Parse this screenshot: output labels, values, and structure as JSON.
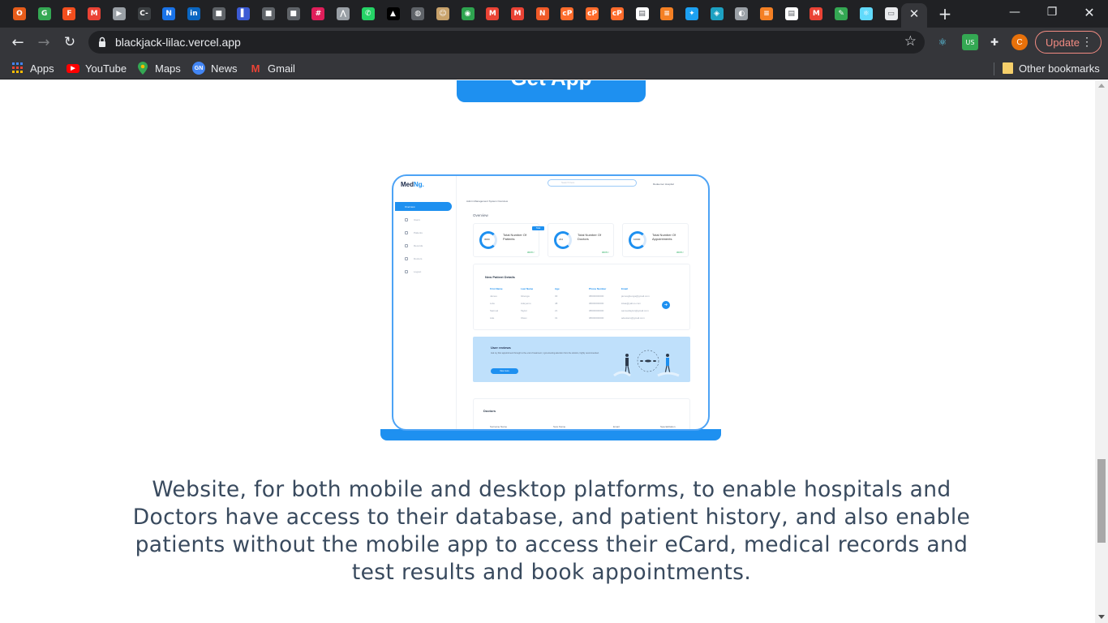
{
  "browser": {
    "tabs": [
      {
        "icon": "opera-icon",
        "color": "#e65c1a",
        "glyph": "O"
      },
      {
        "icon": "chrome-icon",
        "color": "#34a853",
        "glyph": "G"
      },
      {
        "icon": "figma-icon",
        "color": "#f24e1e",
        "glyph": "F"
      },
      {
        "icon": "gmail-icon",
        "color": "#ea4335",
        "glyph": "M"
      },
      {
        "icon": "media-icon",
        "color": "#9aa0a6",
        "glyph": "▶"
      },
      {
        "icon": "codepen-c-icon",
        "color": "#3c4043",
        "glyph": "C-"
      },
      {
        "icon": "notion-n-icon",
        "color": "#1a73e8",
        "glyph": "N"
      },
      {
        "icon": "linkedin-icon",
        "color": "#0a66c2",
        "glyph": "in"
      },
      {
        "icon": "app-icon",
        "color": "#5f6368",
        "glyph": "■"
      },
      {
        "icon": "figure-icon",
        "color": "#3c5bd4",
        "glyph": "▌"
      },
      {
        "icon": "app-icon",
        "color": "#5f6368",
        "glyph": "■"
      },
      {
        "icon": "app-icon",
        "color": "#5f6368",
        "glyph": "■"
      },
      {
        "icon": "slack-icon",
        "color": "#e01e5a",
        "glyph": "#"
      },
      {
        "icon": "mountain-icon",
        "color": "#9aa0a6",
        "glyph": "⋀"
      },
      {
        "icon": "whatsapp-icon",
        "color": "#25d366",
        "glyph": "✆"
      },
      {
        "icon": "vercel-icon",
        "color": "#000000",
        "glyph": "▲"
      },
      {
        "icon": "globe-icon",
        "color": "#5f6368",
        "glyph": "◍"
      },
      {
        "icon": "monkey-icon",
        "color": "#c8a26b",
        "glyph": "☺"
      },
      {
        "icon": "github-icon",
        "color": "#2ea44f",
        "glyph": "◉"
      },
      {
        "icon": "gmail-icon",
        "color": "#ea4335",
        "glyph": "M"
      },
      {
        "icon": "gmail-icon",
        "color": "#ea4335",
        "glyph": "M"
      },
      {
        "icon": "nudge-icon",
        "color": "#f05a28",
        "glyph": "N"
      },
      {
        "icon": "cpanel-icon",
        "color": "#ff6c2c",
        "glyph": "cP"
      },
      {
        "icon": "cpanel-icon",
        "color": "#ff6c2c",
        "glyph": "cP"
      },
      {
        "icon": "cpanel-icon",
        "color": "#ff6c2c",
        "glyph": "cP"
      },
      {
        "icon": "document-icon",
        "color": "#ffffff",
        "glyph": "▤"
      },
      {
        "icon": "stackoverflow-icon",
        "color": "#f48024",
        "glyph": "≡"
      },
      {
        "icon": "twitter-icon",
        "color": "#1da1f2",
        "glyph": "✦"
      },
      {
        "icon": "codepen-icon",
        "color": "#1da1c2",
        "glyph": "◈"
      },
      {
        "icon": "dark-mode-icon",
        "color": "#9aa0a6",
        "glyph": "◐"
      },
      {
        "icon": "stackoverflow-icon",
        "color": "#f48024",
        "glyph": "≡"
      },
      {
        "icon": "document-icon",
        "color": "#ffffff",
        "glyph": "▤"
      },
      {
        "icon": "gmail-icon",
        "color": "#ea4335",
        "glyph": "M"
      },
      {
        "icon": "leaf-icon",
        "color": "#34a853",
        "glyph": "✎"
      },
      {
        "icon": "react-icon",
        "color": "#61dafb",
        "glyph": "⚛"
      },
      {
        "icon": "blank-page-icon",
        "color": "#e8eaed",
        "glyph": "▭"
      }
    ],
    "active_tab_icon": "blank-page-icon",
    "url": "blackjack-lilac.vercel.app",
    "update_label": "Update",
    "profile_initial": "C",
    "extensions": [
      {
        "icon": "react-devtools-icon",
        "color": "#61dafb",
        "glyph": "⚛"
      },
      {
        "icon": "vpn-us-icon",
        "color": "#34a853",
        "glyph": "US"
      },
      {
        "icon": "puzzle-extensions-icon",
        "color": "#e8eaed",
        "glyph": "✚"
      }
    ]
  },
  "bookmarks": {
    "apps": "Apps",
    "youtube": "YouTube",
    "maps": "Maps",
    "news": "News",
    "gmail": "Gmail",
    "other": "Other bookmarks"
  },
  "page": {
    "get_app_label": "Get App",
    "description": "Website, for both mobile and desktop platforms, to enable hospitals and Doctors have access to their database, and patient history, and also enable patients without the mobile app to access their eCard, medical records and test results and book appointments.",
    "mockup": {
      "logo_a": "Med",
      "logo_b": "Ng.",
      "nav_active": "Overview",
      "nav": [
        "Users",
        "Patients",
        "Records",
        "Doctors",
        "Logout"
      ],
      "search_placeholder": "Search here",
      "hospital": "Redeemer Hospital",
      "crumb": "Admin Management System Overview",
      "overview": "Overview",
      "cards": [
        {
          "value": "3000",
          "label": "Total Number Of Patients",
          "foot": "300%↑",
          "tag": "Total"
        },
        {
          "value": "244",
          "label": "Total Number Of Doctors",
          "foot": "300%↑"
        },
        {
          "value": "10000",
          "label": "Total Number Of Appointments",
          "foot": "300%↑"
        }
      ],
      "table_title": "New Patient Details",
      "table_headers": [
        "First Name",
        "Last Name",
        "Age",
        "Phone Number",
        "Email"
      ],
      "table_rows": [
        [
          "James",
          "Gbenga",
          "30",
          "08000000000",
          "jamesgbenga@gmail.com"
        ],
        [
          "Lola",
          "Adeyemo",
          "48",
          "08000000000",
          "lolaa@yahoo.com"
        ],
        [
          "Samuel",
          "Taylor",
          "21",
          "08000000000",
          "samueltaylor@gmail.com"
        ],
        [
          "Ade",
          "Olaxx",
          "31",
          "08000000000",
          "adeolaxx@gmail.com"
        ]
      ],
      "banner_title": "User reviews",
      "banner_text": "Ask my Doc appointment through to the end of treatment, I got amazing attention from the doctors, highly recommended.",
      "banner_button": "View more",
      "doctors_title": "Doctors",
      "doctors_headers": [
        "Surname Name",
        "Sure Name",
        "Email",
        "Specialization"
      ]
    }
  }
}
